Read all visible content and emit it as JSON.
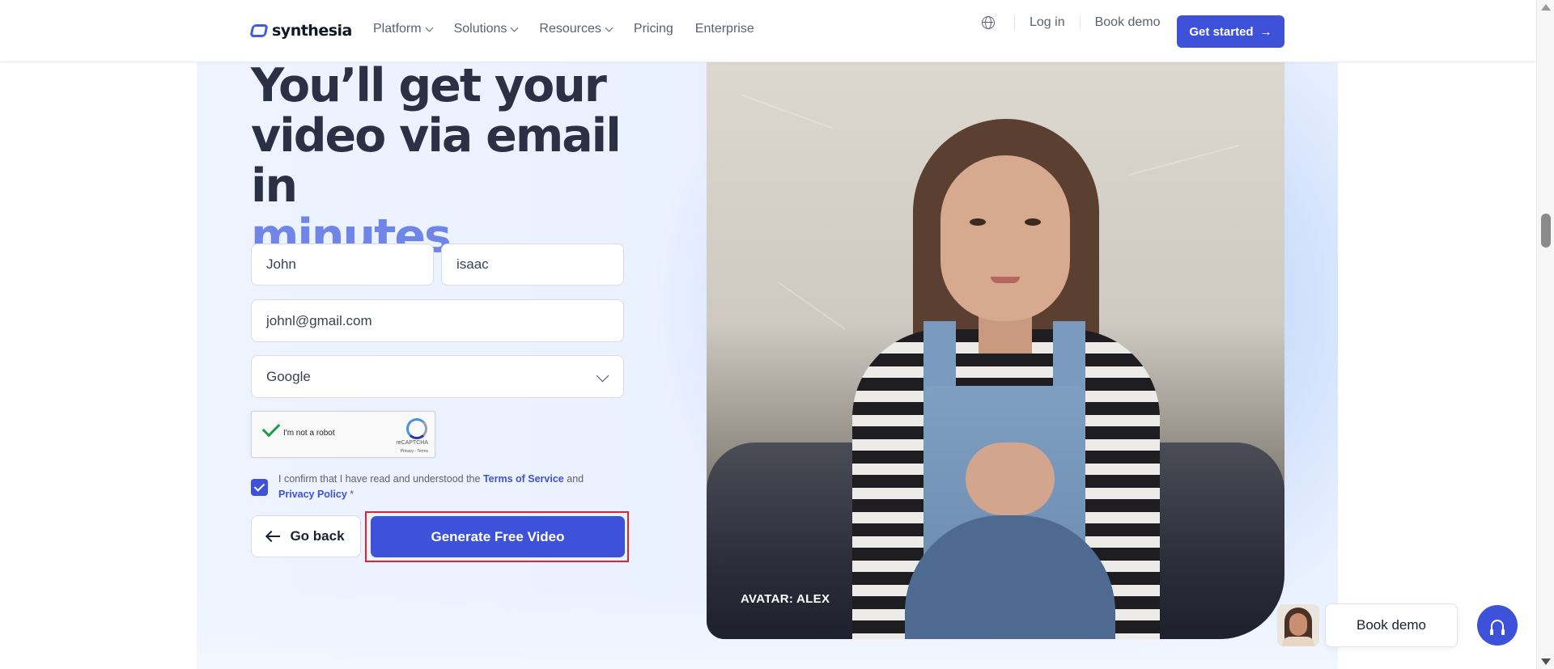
{
  "brand": {
    "name": "synthesia",
    "accent": "#3e51d9"
  },
  "nav": {
    "items": [
      {
        "label": "Platform",
        "has_dropdown": true
      },
      {
        "label": "Solutions",
        "has_dropdown": true
      },
      {
        "label": "Resources",
        "has_dropdown": true
      },
      {
        "label": "Pricing",
        "has_dropdown": false
      },
      {
        "label": "Enterprise",
        "has_dropdown": false
      }
    ],
    "language_icon": "globe-icon",
    "login": "Log in",
    "book_demo": "Book demo",
    "get_started": "Get started"
  },
  "hero": {
    "headline_line1": "You’ll get your",
    "headline_line2": "video via email in",
    "headline_accent": "minutes"
  },
  "form": {
    "first_name": "John",
    "last_name": "isaac",
    "email": "johnl@gmail.com",
    "source_select": "Google",
    "captcha": {
      "label": "I'm not a robot",
      "brand": "reCAPTCHA",
      "terms": "Privacy - Terms",
      "checked": true
    },
    "consent": {
      "checked": true,
      "text_before": "I confirm that I have read and understood the ",
      "terms_link": "Terms of Service",
      "text_middle": " and ",
      "privacy_link": "Privacy Policy",
      "required_mark": " *"
    },
    "back_button": "Go back",
    "submit_button": "Generate Free Video"
  },
  "video": {
    "label": "AVATAR: ALEX"
  },
  "floating": {
    "book_demo": "Book demo",
    "help_icon": "headset-icon"
  }
}
